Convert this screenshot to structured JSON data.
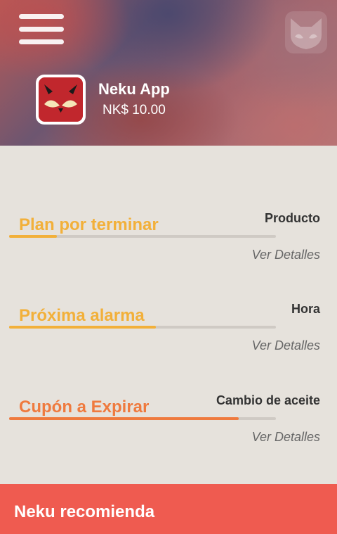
{
  "header": {
    "app_name": "Neku App",
    "price": "NK$ 10.00",
    "menu_icon": "hamburger-menu-icon",
    "logo_icon": "fox-logo-icon"
  },
  "sections": [
    {
      "title": "Plan por terminar",
      "right_label": "Producto",
      "link": "Ver Detalles",
      "progress": 0.18,
      "color": "#f2b03a"
    },
    {
      "title": "Próxima alarma",
      "right_label": "Hora",
      "link": "Ver Detalles",
      "progress": 0.55,
      "color": "#f2b03a"
    },
    {
      "title": "Cupón a Expirar",
      "right_label": "Cambio de aceite",
      "link": "Ver Detalles",
      "progress": 0.86,
      "color": "#ef7a3e"
    }
  ],
  "footer": {
    "title": "Neku recomienda",
    "color": "#ef5b50"
  }
}
